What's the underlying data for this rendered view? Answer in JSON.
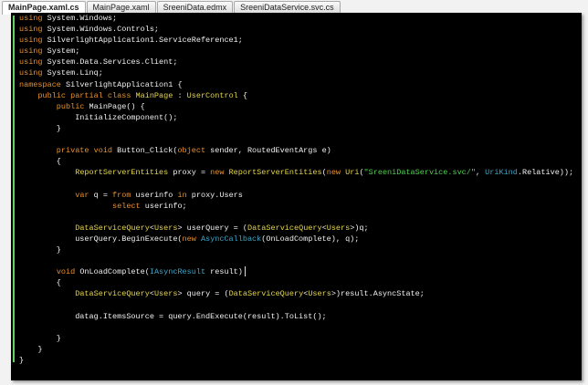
{
  "tabs": [
    {
      "label": "MainPage.xaml.cs",
      "active": true
    },
    {
      "label": "MainPage.xaml"
    },
    {
      "label": "SreeniData.edmx"
    },
    {
      "label": "SreeniDataService.svc.cs"
    }
  ],
  "colors": {
    "keyword": "#e8912c",
    "type": "#e6d64a",
    "string": "#4ed24e",
    "typeref": "#3aa6c8",
    "background": "#000000"
  },
  "code": [
    [
      [
        "using",
        "kw"
      ],
      [
        " System.Windows;",
        "id"
      ]
    ],
    [
      [
        "using",
        "kw"
      ],
      [
        " System.Windows.Controls;",
        "id"
      ]
    ],
    [
      [
        "using",
        "kw"
      ],
      [
        " SilverlightApplication1.ServiceReference1;",
        "id"
      ]
    ],
    [
      [
        "using",
        "kw"
      ],
      [
        " System;",
        "id"
      ]
    ],
    [
      [
        "using",
        "kw"
      ],
      [
        " System.Data.Services.Client;",
        "id"
      ]
    ],
    [
      [
        "using",
        "kw"
      ],
      [
        " System.Linq;",
        "id"
      ]
    ],
    [
      [
        "namespace",
        "kw"
      ],
      [
        " SilverlightApplication1 {",
        "id"
      ]
    ],
    [
      [
        "    public partial class ",
        "kw"
      ],
      [
        "MainPage",
        "ty"
      ],
      [
        " : ",
        "id"
      ],
      [
        "UserControl",
        "ty"
      ],
      [
        " {",
        "id"
      ]
    ],
    [
      [
        "        public ",
        "kw"
      ],
      [
        "MainPage() {",
        "id"
      ]
    ],
    [
      [
        "            InitializeComponent();",
        "id"
      ]
    ],
    [
      [
        "        }",
        "id"
      ]
    ],
    [],
    [
      [
        "        private void ",
        "kw"
      ],
      [
        "Button_Click(",
        "id"
      ],
      [
        "object",
        "kw"
      ],
      [
        " sender, RoutedEventArgs e)",
        "id"
      ]
    ],
    [
      [
        "        {",
        "id"
      ]
    ],
    [
      [
        "            ",
        "id"
      ],
      [
        "ReportServerEntities",
        "ty"
      ],
      [
        " proxy = ",
        "id"
      ],
      [
        "new ",
        "kw"
      ],
      [
        "ReportServerEntities",
        "ty"
      ],
      [
        "(",
        "id"
      ],
      [
        "new ",
        "kw"
      ],
      [
        "Uri",
        "ty"
      ],
      [
        "(",
        "id"
      ],
      [
        "\"SreeniDataService.svc/\"",
        "st"
      ],
      [
        ", ",
        "id"
      ],
      [
        "UriKind",
        "tb"
      ],
      [
        ".Relative));",
        "id"
      ]
    ],
    [],
    [
      [
        "            ",
        "id"
      ],
      [
        "var",
        "kw"
      ],
      [
        " q = ",
        "id"
      ],
      [
        "from",
        "kw"
      ],
      [
        " userinfo ",
        "id"
      ],
      [
        "in",
        "kw"
      ],
      [
        " proxy.Users",
        "id"
      ]
    ],
    [
      [
        "                    ",
        "id"
      ],
      [
        "select",
        "kw"
      ],
      [
        " userinfo;",
        "id"
      ]
    ],
    [],
    [
      [
        "            ",
        "id"
      ],
      [
        "DataServiceQuery",
        "ty"
      ],
      [
        "<",
        "id"
      ],
      [
        "Users",
        "ty"
      ],
      [
        "> userQuery = (",
        "id"
      ],
      [
        "DataServiceQuery",
        "ty"
      ],
      [
        "<",
        "id"
      ],
      [
        "Users",
        "ty"
      ],
      [
        ">)q;",
        "id"
      ]
    ],
    [
      [
        "            userQuery.BeginExecute(",
        "id"
      ],
      [
        "new ",
        "kw"
      ],
      [
        "AsyncCallback",
        "tb"
      ],
      [
        "(OnLoadComplete), q);",
        "id"
      ]
    ],
    [
      [
        "        }",
        "id"
      ]
    ],
    [],
    [
      [
        "        ",
        "id"
      ],
      [
        "void",
        "kw"
      ],
      [
        " OnLoadComplete(",
        "id"
      ],
      [
        "IAsyncResult",
        "tb"
      ],
      [
        " result)",
        "id"
      ]
    ],
    [
      [
        "        {",
        "id"
      ]
    ],
    [
      [
        "            ",
        "id"
      ],
      [
        "DataServiceQuery",
        "ty"
      ],
      [
        "<",
        "id"
      ],
      [
        "Users",
        "ty"
      ],
      [
        "> query = (",
        "id"
      ],
      [
        "DataServiceQuery",
        "ty"
      ],
      [
        "<",
        "id"
      ],
      [
        "Users",
        "ty"
      ],
      [
        ">)result.AsyncState;",
        "id"
      ]
    ],
    [],
    [
      [
        "            datag.ItemsSource = query.EndExecute(result).ToList();",
        "id"
      ]
    ],
    [],
    [
      [
        "        }",
        "id"
      ]
    ],
    [
      [
        "    }",
        "id"
      ]
    ],
    [
      [
        "}",
        "id"
      ]
    ]
  ]
}
